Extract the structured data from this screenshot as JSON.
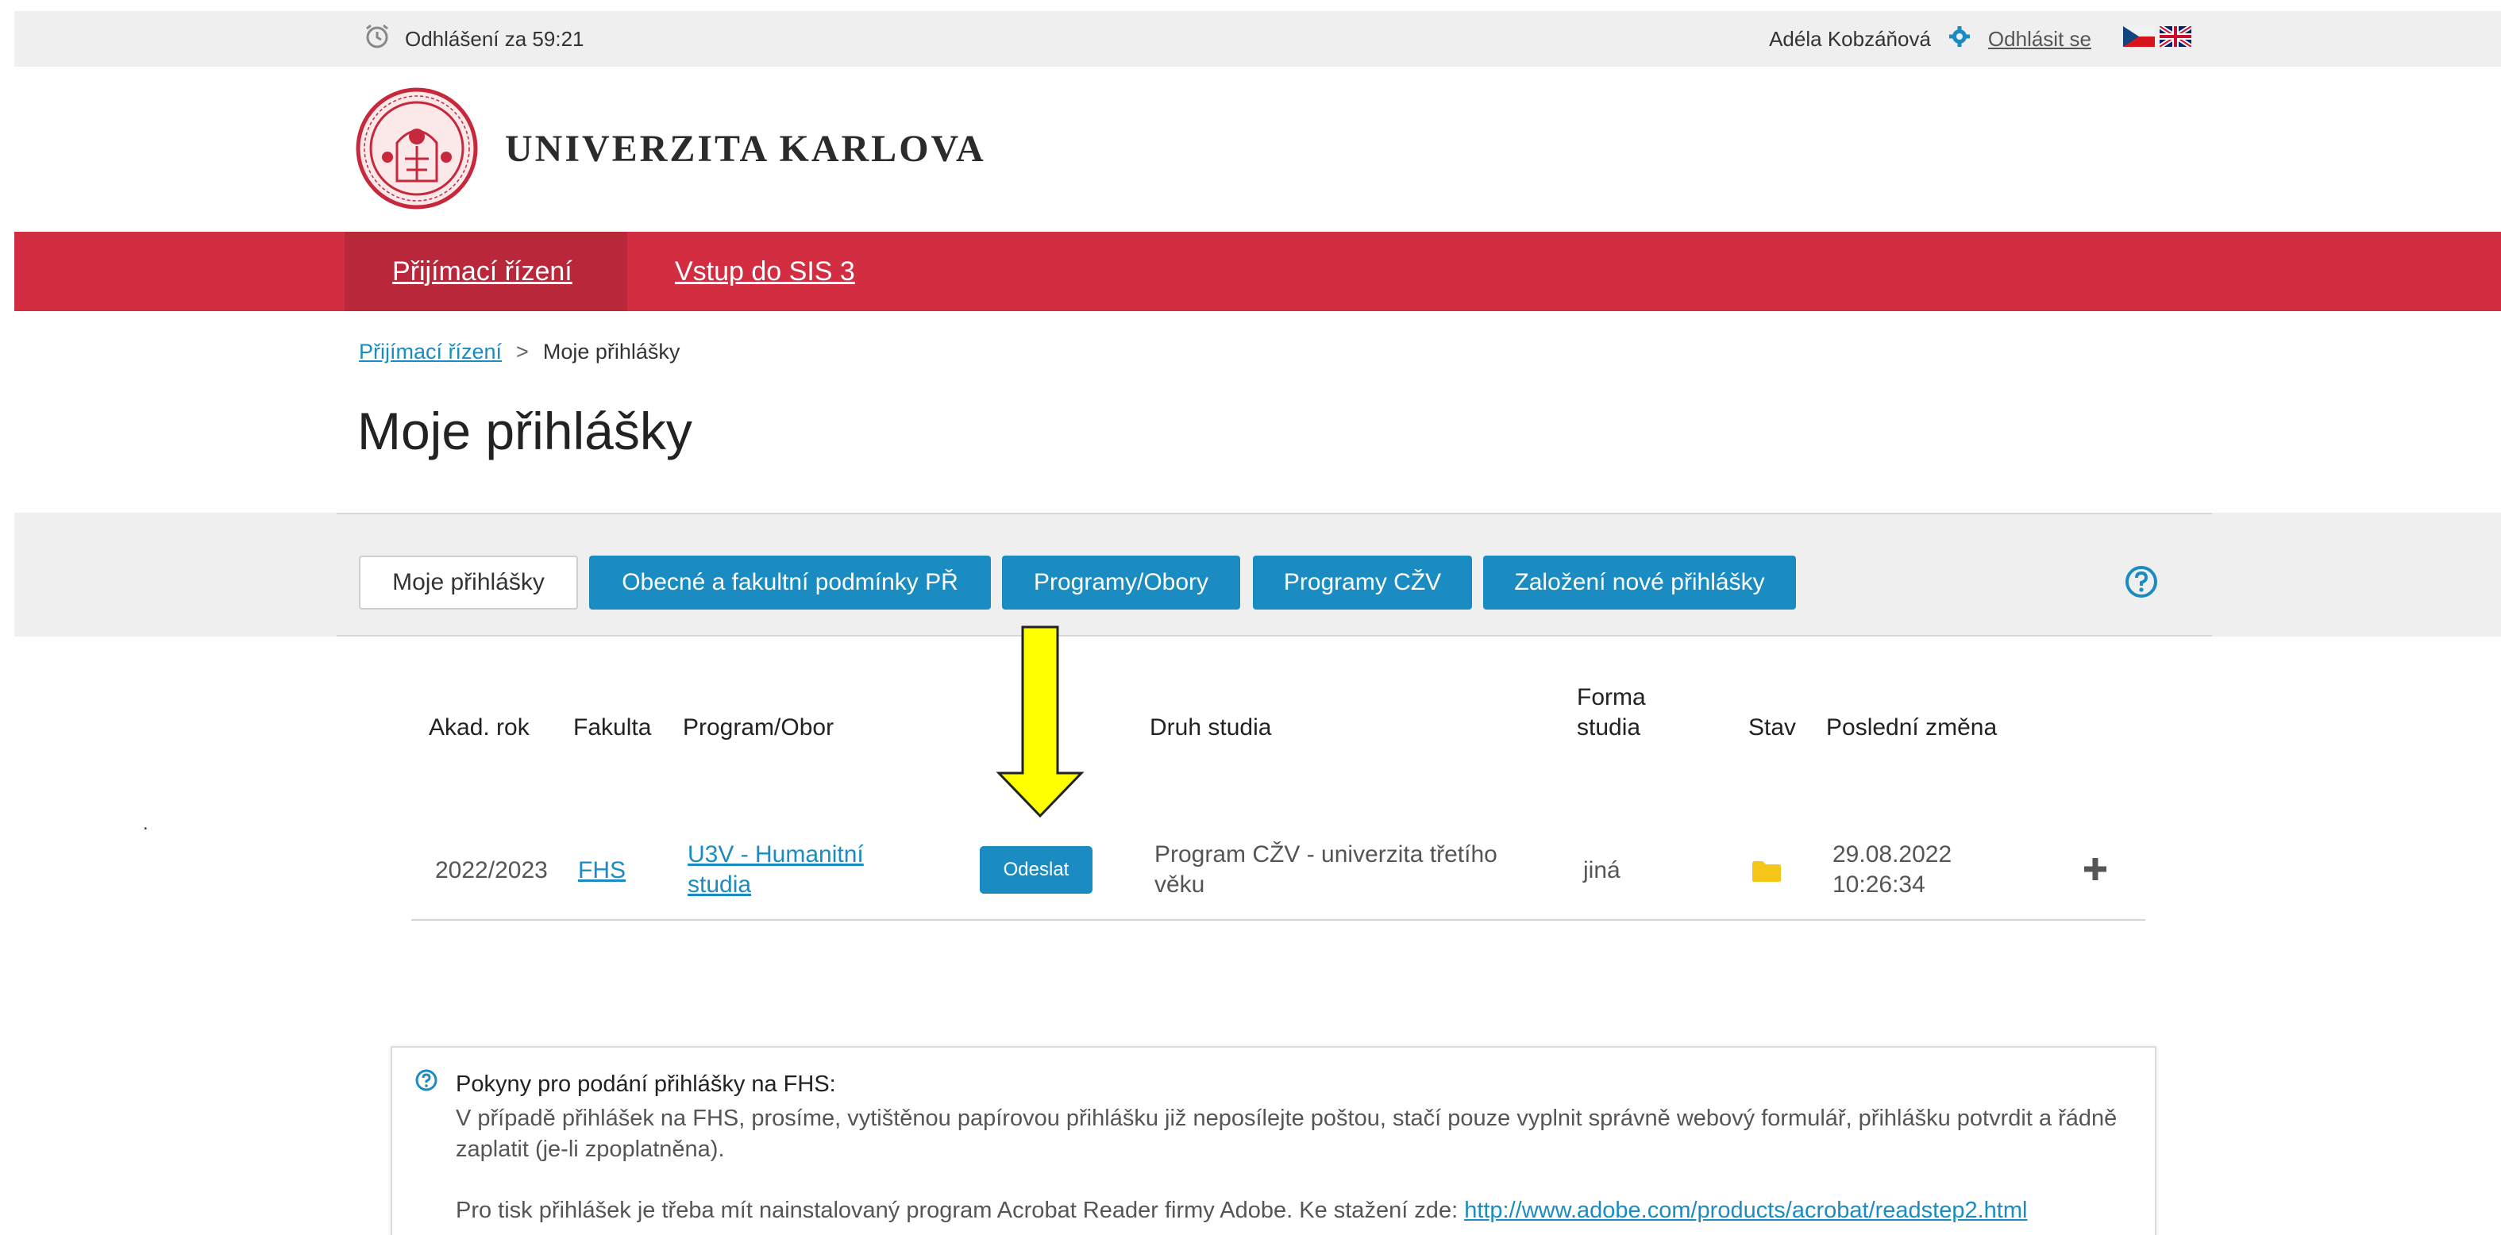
{
  "topbar": {
    "timer_label": "Odhlášení za 59:21",
    "user_name": "Adéla Kobzáňová",
    "logout_label": "Odhlásit se"
  },
  "header": {
    "brand": "UNIVERZITA KARLOVA"
  },
  "nav": {
    "items": [
      {
        "label": "Přijímací řízení"
      },
      {
        "label": "Vstup do SIS 3"
      }
    ]
  },
  "breadcrumb": {
    "link": "Přijímací řízení",
    "separator": ">",
    "current": "Moje přihlášky"
  },
  "page_title": "Moje přihlášky",
  "tabs": [
    {
      "label": "Moje přihlášky"
    },
    {
      "label": "Obecné a fakultní podmínky PŘ"
    },
    {
      "label": "Programy/Obory"
    },
    {
      "label": "Programy CŽV"
    },
    {
      "label": "Založení nové přihlášky"
    }
  ],
  "table": {
    "headers": {
      "year": "Akad. rok",
      "faculty": "Fakulta",
      "program": "Program/Obor",
      "type": "Druh studia",
      "form": "Forma studia",
      "state": "Stav",
      "changed": "Poslední změna"
    },
    "rows": [
      {
        "year": "2022/2023",
        "faculty": "FHS",
        "program": "U3V - Humanitní studia",
        "send_label": "Odeslat",
        "type": "Program CŽV - univerzita třetího věku",
        "form": "jiná",
        "changed": "29.08.2022 10:26:34"
      }
    ]
  },
  "stray_mark": ".",
  "info": {
    "title": "Pokyny pro podání přihlášky na FHS:",
    "text": "V případě přihlášek na FHS, prosíme, vytištěnou papírovou přihlášku již neposílejte poštou, stačí pouze vyplnit správně webový formulář, přihlášku potvrdit a řádně zaplatit (je-li zpoplatněna).",
    "text2": "Pro tisk přihlášek je třeba mít nainstalovaný program Acrobat Reader firmy Adobe. Ke stažení zde:",
    "link": "http://www.adobe.com/products/acrobat/readstep2.html"
  },
  "colors": {
    "brand_red": "#d32d41",
    "accent_blue": "#1a8cc1",
    "arrow_yellow": "#ffff00",
    "folder_yellow": "#f5c518"
  },
  "icons": [
    "clock-icon",
    "settings-icon",
    "flag-cz-icon",
    "flag-uk-icon",
    "university-seal",
    "help-icon",
    "arrow-down-annotation",
    "folder-icon",
    "plus-icon",
    "info-icon"
  ]
}
